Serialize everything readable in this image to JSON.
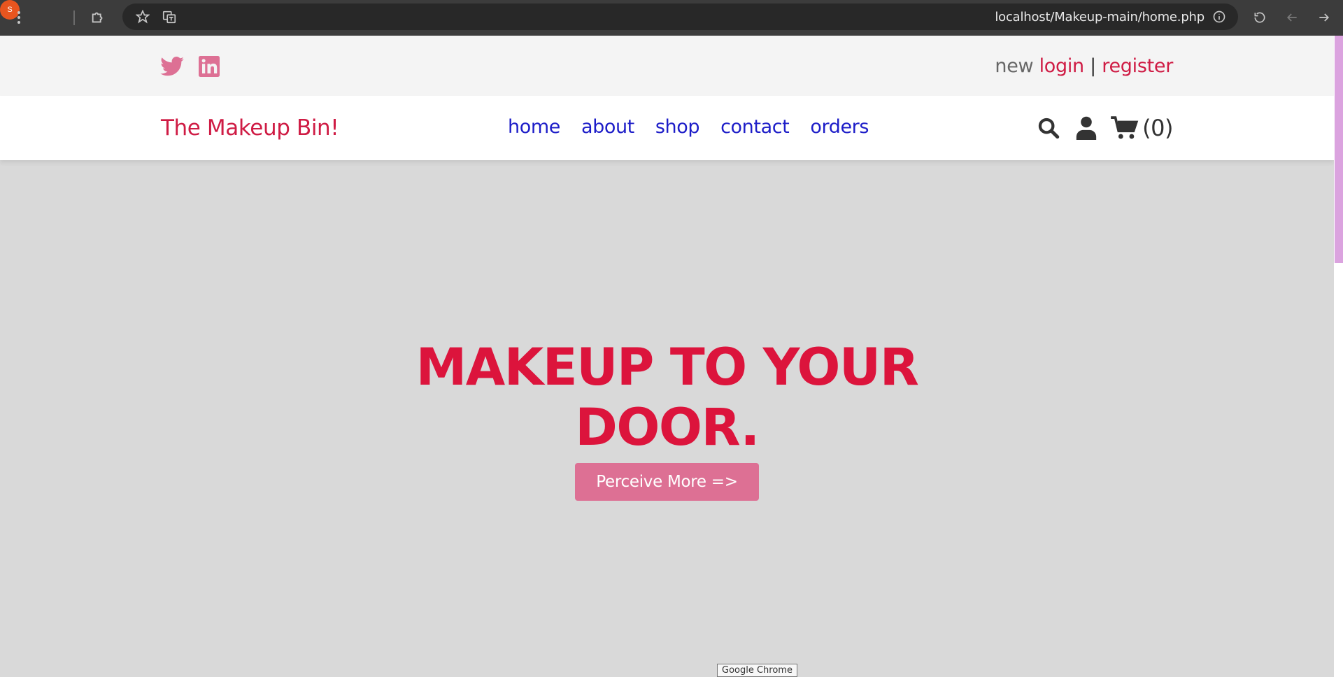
{
  "browser": {
    "profile_initial": "S",
    "url": "localhost/Makeup-main/home.php",
    "icons": [
      "kebab-menu-icon",
      "extensions-icon",
      "star-icon",
      "translate-icon",
      "info-icon",
      "reload-icon",
      "back-icon",
      "forward-icon"
    ],
    "tooltip": "Google Chrome"
  },
  "topbar": {
    "social": [
      "twitter-icon",
      "linkedin-icon"
    ],
    "new_text": "new",
    "login_label": "login",
    "separator": "|",
    "register_label": "register"
  },
  "header": {
    "logo": "The Makeup Bin!",
    "nav": [
      "home",
      "about",
      "shop",
      "contact",
      "orders"
    ],
    "cart_count": "(0)"
  },
  "hero": {
    "title_line1": "MAKEUP TO YOUR",
    "title_line2": "DOOR.",
    "button_label": "Perceive More =>"
  },
  "colors": {
    "brand": "#dc143c",
    "social_pink": "#dd7094",
    "nav_link": "#1d1dc8",
    "hero_bg": "#d9d9d9",
    "button_bg": "#dd7094"
  }
}
